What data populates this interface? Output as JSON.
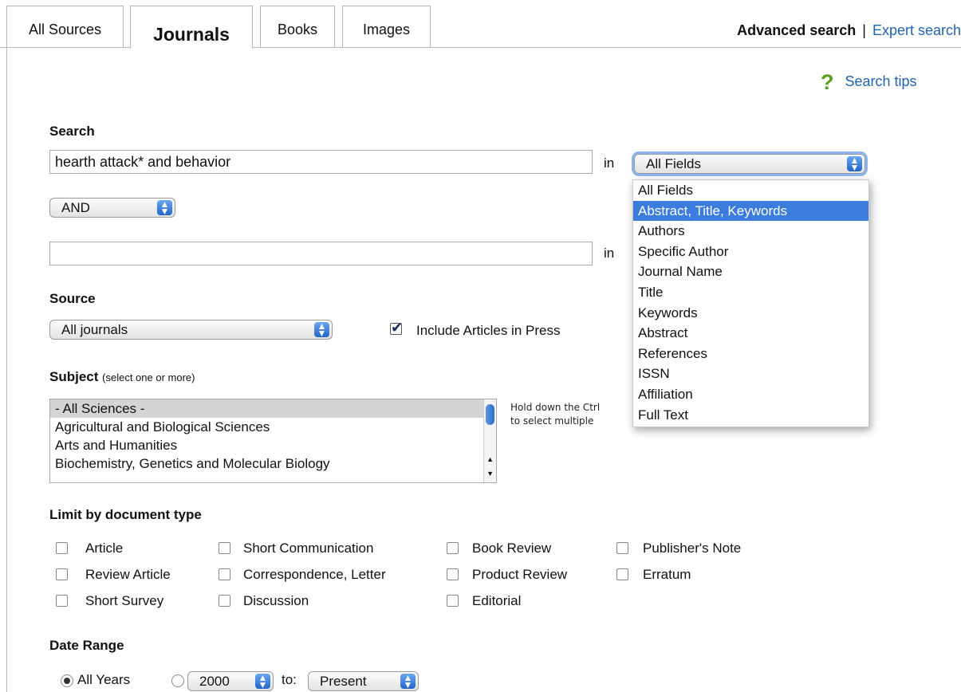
{
  "tabs": [
    {
      "label": "All Sources"
    },
    {
      "label": "Journals"
    },
    {
      "label": "Books"
    },
    {
      "label": "Images"
    }
  ],
  "top_links": {
    "advanced": "Advanced search",
    "separator": "|",
    "expert": "Expert search"
  },
  "search_tips": {
    "icon": "?",
    "label": "Search tips"
  },
  "search": {
    "label": "Search",
    "field1_value": "hearth attack* and behavior",
    "in_label": "in",
    "field1_select": "All Fields",
    "bool_op": "AND",
    "field2_value": "",
    "in_label2": "in"
  },
  "dropdown_options": [
    "All Fields",
    "Abstract, Title, Keywords",
    "Authors",
    "Specific Author",
    "Journal Name",
    "Title",
    "Keywords",
    "Abstract",
    "References",
    "ISSN",
    "Affiliation",
    "Full Text"
  ],
  "dropdown_highlighted": "Abstract, Title, Keywords",
  "source": {
    "label": "Source",
    "select": "All journals",
    "include_press": "Include Articles in Press",
    "include_press_checked": true
  },
  "subject": {
    "label": "Subject",
    "hint": "(select one or more)",
    "options": [
      "- All Sciences -",
      "Agricultural and Biological Sciences",
      "Arts and Humanities",
      "Biochemistry, Genetics and Molecular Biology"
    ],
    "selected": "- All Sciences -",
    "help_line1": "Hold down the Ctrl",
    "help_line2": "to select multiple"
  },
  "doc_type": {
    "label": "Limit by document type",
    "items": [
      "Article",
      "Short Communication",
      "Book Review",
      "Publisher's Note",
      "Review Article",
      "Correspondence, Letter",
      "Product Review",
      "Erratum",
      "Short Survey",
      "Discussion",
      "Editorial"
    ]
  },
  "date_range": {
    "label": "Date Range",
    "all_years": "All Years",
    "from": "2000",
    "to_label": "to:",
    "to": "Present",
    "all_years_selected": true
  }
}
